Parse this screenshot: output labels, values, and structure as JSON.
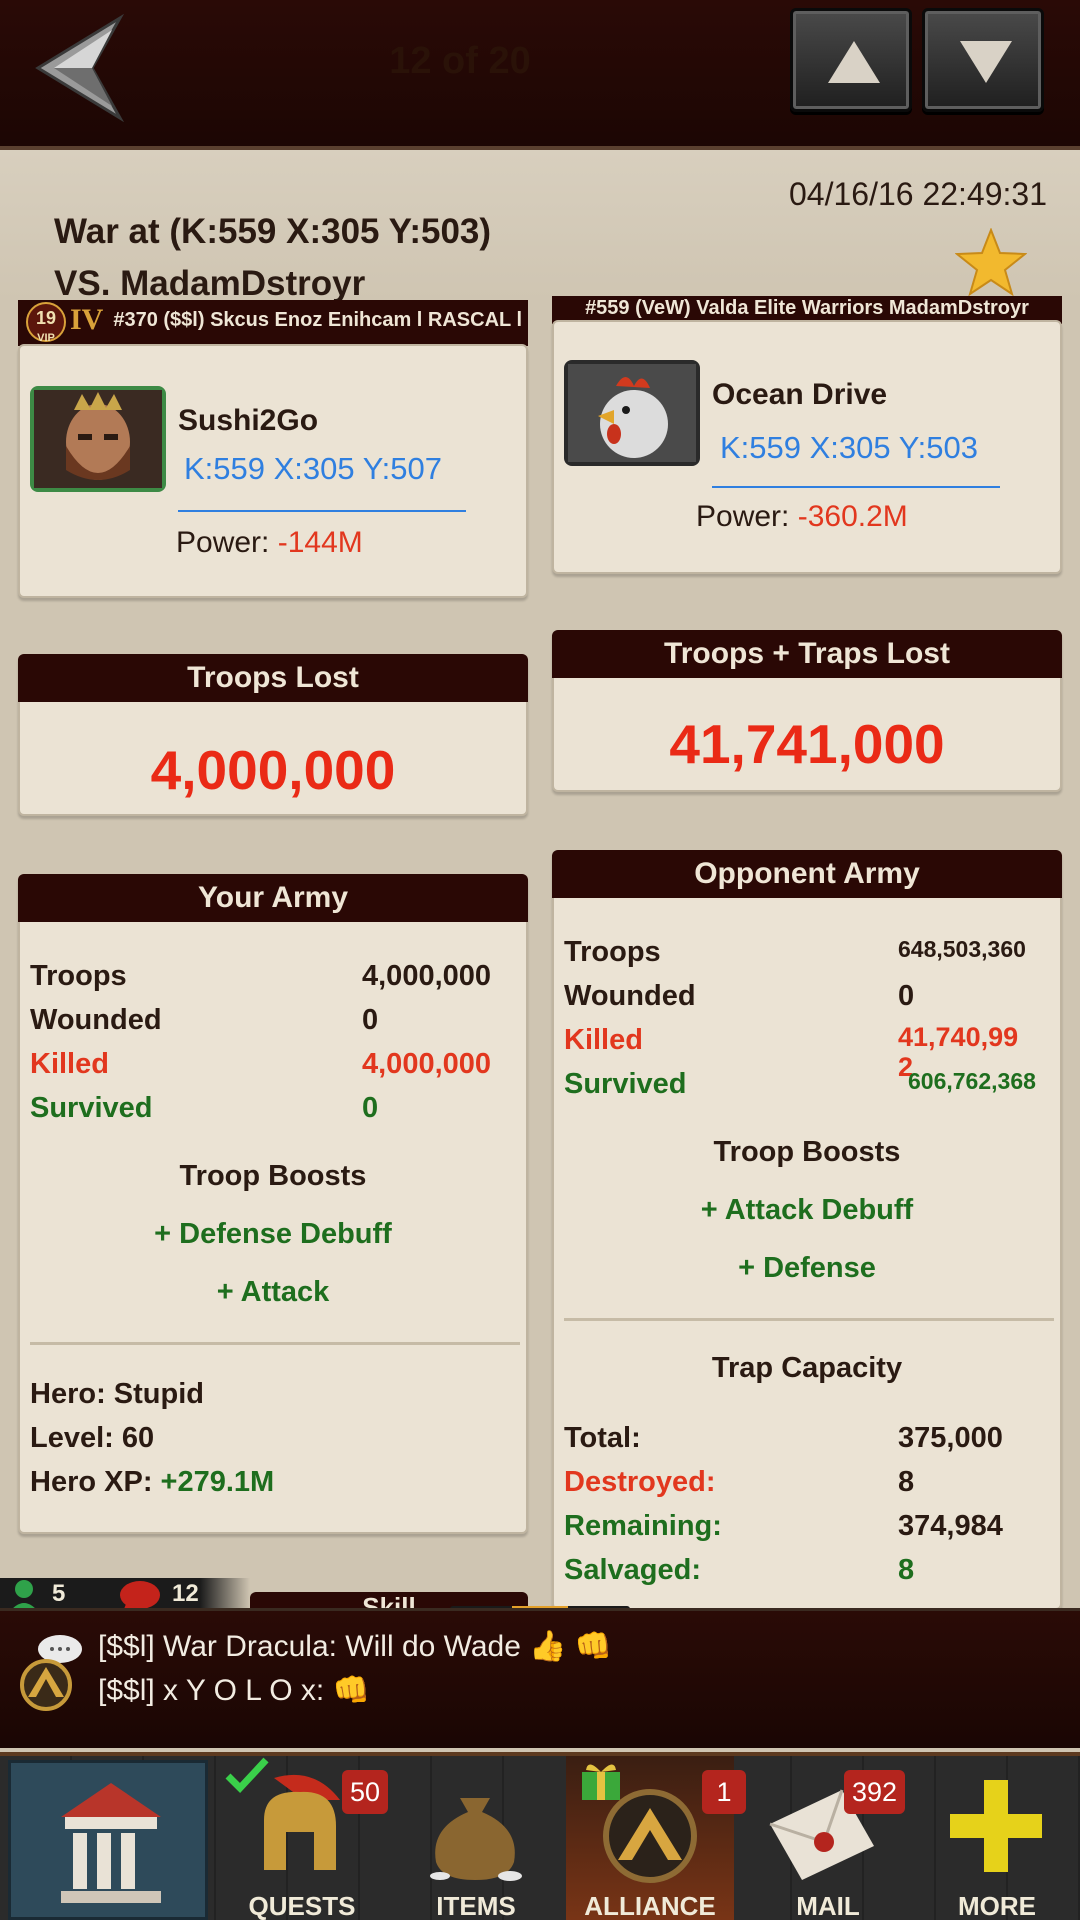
{
  "topbar": {
    "page_counter": "12 of 20"
  },
  "report": {
    "date": "04/16/16 22:49:31",
    "title_line1": "War at (K:559 X:305 Y:503)",
    "title_line2": "VS. MadamDstroyr"
  },
  "player": {
    "alliance_strip": "#370 ($$l) Skcus Enoz Enihcam l RASCAL l",
    "vip_level": "19",
    "vip_label": "VIP",
    "rank": "IV",
    "name": "Sushi2Go",
    "coords": "K:559 X:305 Y:507",
    "power_label": "Power: ",
    "power_value": "-144M"
  },
  "opponent": {
    "alliance_strip": "#559 (VeW) Valda Elite Warriors MadamDstroyr",
    "name": "Ocean Drive",
    "coords": "K:559 X:305 Y:503",
    "power_label": "Power: ",
    "power_value": "-360.2M"
  },
  "losses": {
    "left_title": "Troops Lost",
    "left_value": "4,000,000",
    "right_title": "Troops + Traps Lost",
    "right_value": "41,741,000"
  },
  "your_army": {
    "title": "Your Army",
    "rows": [
      {
        "label": "Troops",
        "value": "4,000,000"
      },
      {
        "label": "Wounded",
        "value": "0"
      },
      {
        "label": "Killed",
        "value": "4,000,000"
      },
      {
        "label": "Survived",
        "value": "0"
      }
    ],
    "boosts_title": "Troop Boosts",
    "boosts": [
      "+ Defense Debuff",
      "+ Attack"
    ],
    "hero_name": "Hero: Stupid",
    "hero_level": "Level: 60",
    "hero_xp_label": "Hero XP: ",
    "hero_xp_value": "+279.1M",
    "next_section_partial": "Skill"
  },
  "opponent_army": {
    "title": "Opponent Army",
    "rows": [
      {
        "label": "Troops",
        "value": "648,503,360"
      },
      {
        "label": "Wounded",
        "value": "0"
      },
      {
        "label": "Killed",
        "value_line1": "41,740,99",
        "value_line2": "2"
      },
      {
        "label": "Survived",
        "value": "606,762,368"
      }
    ],
    "boosts_title": "Troop Boosts",
    "boosts": [
      "+ Attack Debuff",
      "+ Defense"
    ],
    "trap_title": "Trap Capacity",
    "trap_rows": [
      {
        "label": "Total:",
        "value": "375,000"
      },
      {
        "label": "Destroyed:",
        "value": "8"
      },
      {
        "label": "Remaining:",
        "value": "374,984"
      },
      {
        "label": "Salvaged:",
        "value": "8"
      }
    ]
  },
  "chat": {
    "online_count": "5",
    "message_count": "12",
    "lines": [
      "[$$l] War Dracula: Will do Wade  👍 👊",
      "[$$l] x Y O L O x: 👊"
    ]
  },
  "nav": {
    "items": [
      {
        "label": "",
        "icon": "stronghold-icon"
      },
      {
        "label": "QUESTS",
        "badge": "50",
        "icon": "spartan-helmet-icon"
      },
      {
        "label": "ITEMS",
        "icon": "gold-bag-icon"
      },
      {
        "label": "ALLIANCE",
        "badge": "1",
        "icon": "alliance-icon"
      },
      {
        "label": "MAIL",
        "badge": "392",
        "icon": "mail-icon"
      },
      {
        "label": "MORE",
        "icon": "plus-icon"
      }
    ]
  },
  "colors": {
    "header_dark": "#2a0805",
    "panel_bg": "#ebe3d4",
    "loss_red": "#ea2a16",
    "link_blue": "#2f7fe0",
    "boost_green": "#1e6e1e"
  }
}
